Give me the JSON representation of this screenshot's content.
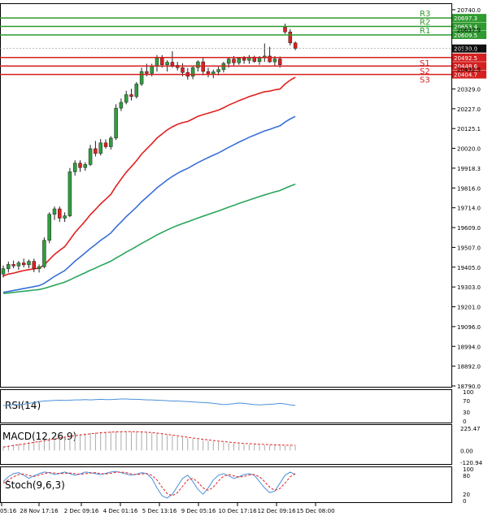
{
  "colors": {
    "bull": "#2e9e3e",
    "bear": "#e02020",
    "ema_fast": "#e02020",
    "ema_mid": "#3a6fd8",
    "ema_slow": "#2aa55a",
    "resistance": "#2f9a2f",
    "support": "#d42020",
    "price_tag": "#111111",
    "rsi": "#4a90d9",
    "macd_hist": "#aaaaaa",
    "macd_signal": "#e02020",
    "stoch_k": "#4a90d9",
    "stoch_d": "#e02020"
  },
  "chart_data": [
    {
      "type": "candlestick",
      "panel": "price",
      "ylim": [
        18790,
        20740
      ],
      "y_ticks": [
        "20740.0",
        "20637.9",
        "20535.6",
        "20432.9",
        "20329.0",
        "20227.0",
        "20125.1",
        "20020.0",
        "19918.3",
        "19816.0",
        "19714.0",
        "19609.0",
        "19507.0",
        "19405.0",
        "19303.0",
        "19201.0",
        "19096.0",
        "18994.0",
        "18892.0",
        "18790.0"
      ],
      "x_ticks": [
        "05:16",
        "28 Nov 17:16",
        "2 Dec 09:16",
        "4 Dec 01:16",
        "5 Dec 13:16",
        "9 Dec 05:16",
        "10 Dec 17:16",
        "12 Dec 09:16",
        "15 Dec 08:00"
      ],
      "candles": [
        {
          "o": 19370,
          "h": 19415,
          "l": 19352,
          "c": 19398
        },
        {
          "o": 19398,
          "h": 19435,
          "l": 19378,
          "c": 19420
        },
        {
          "o": 19420,
          "h": 19440,
          "l": 19400,
          "c": 19412
        },
        {
          "o": 19412,
          "h": 19438,
          "l": 19392,
          "c": 19428
        },
        {
          "o": 19428,
          "h": 19450,
          "l": 19405,
          "c": 19418
        },
        {
          "o": 19418,
          "h": 19445,
          "l": 19400,
          "c": 19436
        },
        {
          "o": 19436,
          "h": 19450,
          "l": 19380,
          "c": 19398
        },
        {
          "o": 19398,
          "h": 19420,
          "l": 19378,
          "c": 19408
        },
        {
          "o": 19408,
          "h": 19560,
          "l": 19400,
          "c": 19545
        },
        {
          "o": 19545,
          "h": 19690,
          "l": 19530,
          "c": 19680
        },
        {
          "o": 19680,
          "h": 19720,
          "l": 19650,
          "c": 19708
        },
        {
          "o": 19708,
          "h": 19720,
          "l": 19640,
          "c": 19660
        },
        {
          "o": 19660,
          "h": 19690,
          "l": 19640,
          "c": 19672
        },
        {
          "o": 19672,
          "h": 19920,
          "l": 19665,
          "c": 19900
        },
        {
          "o": 19900,
          "h": 19960,
          "l": 19880,
          "c": 19945
        },
        {
          "o": 19945,
          "h": 19960,
          "l": 19900,
          "c": 19922
        },
        {
          "o": 19922,
          "h": 19950,
          "l": 19905,
          "c": 19938
        },
        {
          "o": 19938,
          "h": 20040,
          "l": 19930,
          "c": 20020
        },
        {
          "o": 20020,
          "h": 20060,
          "l": 19980,
          "c": 19995
        },
        {
          "o": 19995,
          "h": 20070,
          "l": 19985,
          "c": 20050
        },
        {
          "o": 20050,
          "h": 20068,
          "l": 20020,
          "c": 20030
        },
        {
          "o": 20030,
          "h": 20085,
          "l": 20015,
          "c": 20075
        },
        {
          "o": 20075,
          "h": 20250,
          "l": 20065,
          "c": 20230
        },
        {
          "o": 20230,
          "h": 20280,
          "l": 20215,
          "c": 20260
        },
        {
          "o": 20260,
          "h": 20320,
          "l": 20250,
          "c": 20300
        },
        {
          "o": 20300,
          "h": 20330,
          "l": 20270,
          "c": 20290
        },
        {
          "o": 20290,
          "h": 20365,
          "l": 20280,
          "c": 20355
        },
        {
          "o": 20355,
          "h": 20440,
          "l": 20345,
          "c": 20420
        },
        {
          "o": 20420,
          "h": 20460,
          "l": 20395,
          "c": 20410
        },
        {
          "o": 20410,
          "h": 20460,
          "l": 20395,
          "c": 20448
        },
        {
          "o": 20448,
          "h": 20505,
          "l": 20420,
          "c": 20490
        },
        {
          "o": 20490,
          "h": 20505,
          "l": 20440,
          "c": 20455
        },
        {
          "o": 20455,
          "h": 20478,
          "l": 20420,
          "c": 20468
        },
        {
          "o": 20468,
          "h": 20525,
          "l": 20440,
          "c": 20452
        },
        {
          "o": 20452,
          "h": 20470,
          "l": 20425,
          "c": 20440
        },
        {
          "o": 20440,
          "h": 20462,
          "l": 20395,
          "c": 20415
        },
        {
          "o": 20415,
          "h": 20438,
          "l": 20378,
          "c": 20395
        },
        {
          "o": 20395,
          "h": 20450,
          "l": 20380,
          "c": 20440
        },
        {
          "o": 20440,
          "h": 20478,
          "l": 20420,
          "c": 20470
        },
        {
          "o": 20470,
          "h": 20490,
          "l": 20400,
          "c": 20420
        },
        {
          "o": 20420,
          "h": 20440,
          "l": 20390,
          "c": 20405
        },
        {
          "o": 20405,
          "h": 20430,
          "l": 20385,
          "c": 20418
        },
        {
          "o": 20418,
          "h": 20445,
          "l": 20400,
          "c": 20430
        },
        {
          "o": 20430,
          "h": 20470,
          "l": 20415,
          "c": 20462
        },
        {
          "o": 20462,
          "h": 20495,
          "l": 20440,
          "c": 20485
        },
        {
          "o": 20485,
          "h": 20500,
          "l": 20450,
          "c": 20465
        },
        {
          "o": 20465,
          "h": 20495,
          "l": 20455,
          "c": 20488
        },
        {
          "o": 20488,
          "h": 20500,
          "l": 20460,
          "c": 20478
        },
        {
          "o": 20478,
          "h": 20505,
          "l": 20460,
          "c": 20495
        },
        {
          "o": 20495,
          "h": 20502,
          "l": 20465,
          "c": 20472
        },
        {
          "o": 20472,
          "h": 20500,
          "l": 20455,
          "c": 20490
        },
        {
          "o": 20490,
          "h": 20565,
          "l": 20470,
          "c": 20500
        },
        {
          "o": 20500,
          "h": 20548,
          "l": 20465,
          "c": 20470
        },
        {
          "o": 20470,
          "h": 20500,
          "l": 20445,
          "c": 20485
        },
        {
          "o": 20485,
          "h": 20498,
          "l": 20440,
          "c": 20455
        },
        {
          "o": 20650,
          "h": 20668,
          "l": 20615,
          "c": 20625
        },
        {
          "o": 20625,
          "h": 20640,
          "l": 20555,
          "c": 20568
        },
        {
          "o": 20568,
          "h": 20575,
          "l": 20530,
          "c": 20540
        }
      ],
      "ema_fast": [
        19360,
        19370,
        19375,
        19382,
        19388,
        19393,
        19397,
        19400,
        19418,
        19445,
        19472,
        19493,
        19512,
        19548,
        19585,
        19615,
        19645,
        19678,
        19705,
        19734,
        19758,
        19783,
        19825,
        19862,
        19898,
        19927,
        19957,
        19992,
        20019,
        20046,
        20075,
        20096,
        20117,
        20133,
        20146,
        20155,
        20161,
        20174,
        20188,
        20196,
        20204,
        20212,
        20220,
        20232,
        20246,
        20257,
        20269,
        20279,
        20290,
        20298,
        20307,
        20315,
        20318,
        20325,
        20329,
        20355,
        20375,
        20390
      ],
      "ema_mid": [
        19275,
        19280,
        19285,
        19290,
        19295,
        19300,
        19305,
        19310,
        19322,
        19340,
        19358,
        19373,
        19388,
        19412,
        19437,
        19458,
        19480,
        19503,
        19523,
        19545,
        19563,
        19583,
        19613,
        19640,
        19668,
        19692,
        19717,
        19745,
        19768,
        19792,
        19817,
        19837,
        19858,
        19876,
        19892,
        19906,
        19918,
        19933,
        19948,
        19961,
        19974,
        19986,
        19998,
        20012,
        20027,
        20040,
        20054,
        20066,
        20079,
        20090,
        20101,
        20112,
        20120,
        20130,
        20138,
        20158,
        20174,
        20187
      ],
      "ema_slow": [
        19270,
        19272,
        19275,
        19278,
        19281,
        19284,
        19287,
        19290,
        19296,
        19304,
        19312,
        19320,
        19328,
        19340,
        19353,
        19365,
        19377,
        19390,
        19401,
        19414,
        19425,
        19437,
        19453,
        19468,
        19484,
        19498,
        19513,
        19529,
        19543,
        19558,
        19573,
        19586,
        19599,
        19611,
        19622,
        19632,
        19641,
        19651,
        19661,
        19670,
        19679,
        19688,
        19697,
        19707,
        19717,
        19726,
        19736,
        19745,
        19754,
        19763,
        19772,
        19780,
        19788,
        19796,
        19803,
        19815,
        19826,
        19836
      ],
      "resistance": [
        {
          "label": "R3",
          "value": 20697.3
        },
        {
          "label": "R2",
          "value": 20653.4
        },
        {
          "label": "R1",
          "value": 20609.5
        }
      ],
      "support": [
        {
          "label": "S1",
          "value": 20492.5
        },
        {
          "label": "S2",
          "value": 20448.6
        },
        {
          "label": "S3",
          "value": 20404.7
        }
      ],
      "current_price": 20539.0
    },
    {
      "type": "line",
      "panel": "rsi",
      "title": "RSI(14)",
      "ylim": [
        0,
        100
      ],
      "y_ticks": [
        "100",
        "70",
        "30",
        "0"
      ],
      "values": [
        52,
        54,
        56,
        55,
        57,
        60,
        63,
        66,
        68,
        69,
        70,
        71,
        70,
        71,
        72,
        72,
        73,
        72,
        73,
        74,
        73,
        73,
        74,
        75,
        75,
        74,
        74,
        73,
        72,
        72,
        71,
        70,
        69,
        68,
        68,
        67,
        66,
        65,
        64,
        63,
        62,
        60,
        58,
        56,
        57,
        59,
        61,
        60,
        58,
        56,
        55,
        56,
        57,
        58,
        60,
        58,
        55,
        53
      ]
    },
    {
      "type": "bar",
      "panel": "macd",
      "title": "MACD(12,26,9)",
      "ylim": [
        -120.94,
        225.47
      ],
      "y_ticks": [
        "225.47",
        "0.00",
        "-120.94"
      ],
      "histogram": [
        40,
        50,
        60,
        68,
        75,
        82,
        90,
        98,
        108,
        118,
        128,
        137,
        145,
        153,
        160,
        166,
        172,
        177,
        182,
        186,
        189,
        191,
        193,
        194,
        194,
        193,
        191,
        188,
        184,
        179,
        173,
        166,
        158,
        150,
        142,
        134,
        126,
        118,
        111,
        104,
        97,
        91,
        85,
        80,
        75,
        71,
        67,
        64,
        61,
        58,
        56,
        54,
        52,
        50,
        49,
        48,
        47,
        46
      ],
      "signal": [
        35,
        42,
        50,
        58,
        66,
        74,
        82,
        90,
        99,
        108,
        117,
        126,
        134,
        142,
        150,
        157,
        163,
        169,
        174,
        179,
        183,
        186,
        188,
        190,
        191,
        191,
        190,
        188,
        185,
        181,
        176,
        170,
        163,
        156,
        149,
        142,
        134,
        127,
        120,
        113,
        107,
        101,
        95,
        90,
        85,
        80,
        76,
        72,
        69,
        66,
        63,
        61,
        59,
        57,
        55,
        54,
        53,
        52
      ]
    },
    {
      "type": "line",
      "panel": "stoch",
      "title": "Stoch(9,6,3)",
      "ylim": [
        0,
        100
      ],
      "y_ticks": [
        "100",
        "80",
        "20",
        "0"
      ],
      "k": [
        60,
        75,
        85,
        88,
        80,
        70,
        78,
        85,
        90,
        88,
        82,
        86,
        90,
        85,
        80,
        84,
        90,
        88,
        85,
        82,
        86,
        90,
        92,
        88,
        84,
        80,
        83,
        88,
        85,
        70,
        40,
        15,
        8,
        20,
        45,
        70,
        80,
        60,
        35,
        20,
        40,
        65,
        80,
        85,
        78,
        70,
        75,
        82,
        85,
        80,
        60,
        40,
        25,
        30,
        55,
        80,
        90,
        82
      ],
      "d": [
        55,
        65,
        75,
        82,
        84,
        79,
        76,
        80,
        85,
        88,
        87,
        85,
        86,
        87,
        85,
        83,
        85,
        87,
        88,
        85,
        84,
        86,
        89,
        90,
        88,
        84,
        82,
        84,
        85,
        80,
        65,
        42,
        22,
        15,
        25,
        45,
        65,
        70,
        58,
        40,
        32,
        42,
        62,
        77,
        82,
        78,
        74,
        76,
        81,
        82,
        75,
        60,
        42,
        32,
        38,
        55,
        75,
        85
      ]
    }
  ]
}
